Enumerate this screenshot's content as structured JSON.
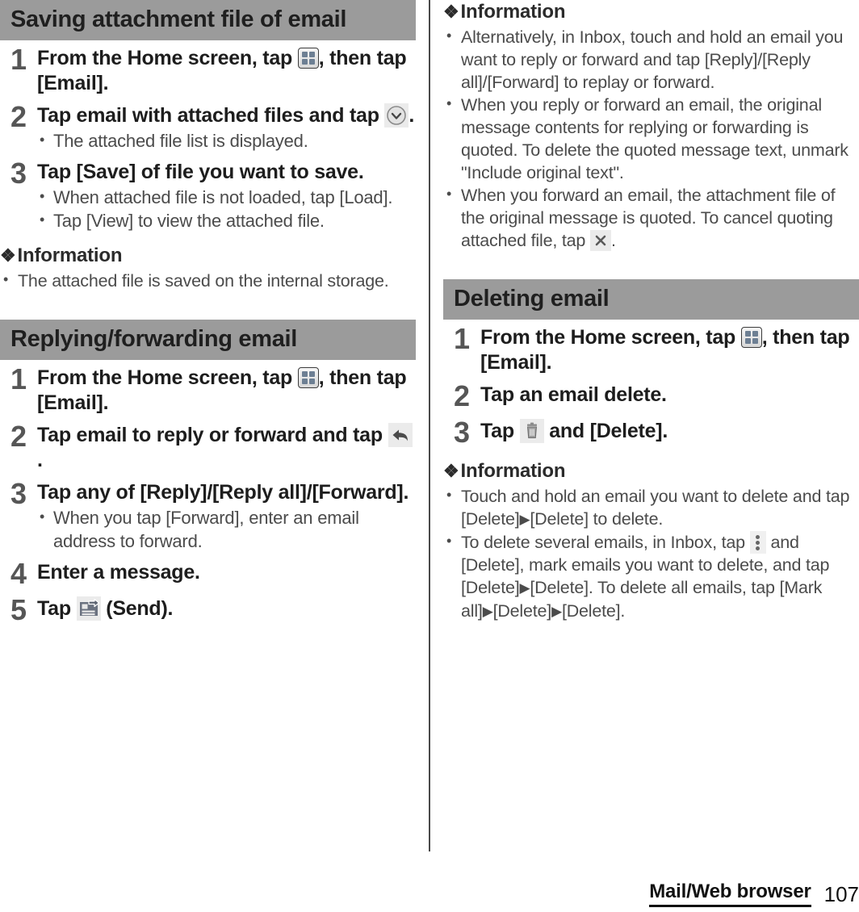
{
  "document": {
    "footer": {
      "chapter": "Mail/Web browser",
      "page_number": "107"
    }
  },
  "left_column": {
    "section1": {
      "heading": "Saving attachment file of email",
      "steps": [
        {
          "num": "1",
          "title_part1": "From the Home screen, tap",
          "icon": "app-drawer-icon",
          "title_part2": ", then tap [Email]."
        },
        {
          "num": "2",
          "title_part1": "Tap email with attached files and tap",
          "icon": "chevron-down-circle-icon",
          "title_part2": ".",
          "bullets": [
            "The attached file list is displayed."
          ]
        },
        {
          "num": "3",
          "title_part1": "Tap [Save] of file you want to save.",
          "bullets": [
            "When attached file is not loaded, tap [Load].",
            "Tap [View] to view the attached file."
          ]
        }
      ],
      "information": {
        "heading": "Information",
        "bullets": [
          "The attached file is saved on the internal storage."
        ]
      }
    },
    "section2": {
      "heading": "Replying/forwarding email",
      "steps": [
        {
          "num": "1",
          "title_part1": "From the Home screen, tap",
          "icon": "app-drawer-icon",
          "title_part2": ", then tap [Email]."
        },
        {
          "num": "2",
          "title_part1": "Tap email to reply or forward and tap",
          "icon": "reply-arrow-icon",
          "title_part2": "."
        },
        {
          "num": "3",
          "title_part1": "Tap any of [Reply]/[Reply all]/[Forward].",
          "bullets": [
            "When you tap [Forward], enter an email address to forward."
          ]
        },
        {
          "num": "4",
          "title_part1": "Enter a message."
        },
        {
          "num": "5",
          "title_part1": "Tap",
          "icon": "send-icon",
          "title_part2": "(Send)."
        }
      ]
    }
  },
  "right_column": {
    "information_top": {
      "heading": "Information",
      "bullets": [
        "Alternatively, in Inbox, touch and hold an email you want to reply or forward and tap [Reply]/[Reply all]/[Forward] to replay or forward.",
        "When you reply or forward an email, the original message contents for replying or forwarding is quoted. To delete the quoted message text, unmark \"Include original text\".",
        "When you forward an email, the attachment file of the original message is quoted. To cancel quoting attached file, tap"
      ],
      "bullet3_icon": "close-x-icon",
      "bullet3_tail": "."
    },
    "section3": {
      "heading": "Deleting email",
      "steps": [
        {
          "num": "1",
          "title_part1": "From the Home screen, tap",
          "icon": "app-drawer-icon",
          "title_part2": ", then tap [Email]."
        },
        {
          "num": "2",
          "title_part1": "Tap an email delete."
        },
        {
          "num": "3",
          "title_part1": "Tap",
          "icon": "trash-icon",
          "title_part2": "and [Delete]."
        }
      ],
      "information": {
        "heading": "Information",
        "bullet1_a": "Touch and hold an email you want to delete and tap [Delete]",
        "bullet1_arrow": "▶",
        "bullet1_b": "[Delete] to delete.",
        "bullet2_a": "To delete several emails, in Inbox, tap",
        "bullet2_icon": "overflow-menu-icon",
        "bullet2_b": "and [Delete], mark emails you want to delete, and tap [Delete]",
        "bullet2_c": "[Delete]. To delete all emails, tap [Mark all]",
        "bullet2_d": "[Delete]",
        "bullet2_e": "[Delete]."
      }
    }
  },
  "colors": {
    "section_bar_bg": "#9b9b9b",
    "step_number": "#565656",
    "body_text": "#4b4b4b",
    "heading_text": "#1d1d1d"
  }
}
